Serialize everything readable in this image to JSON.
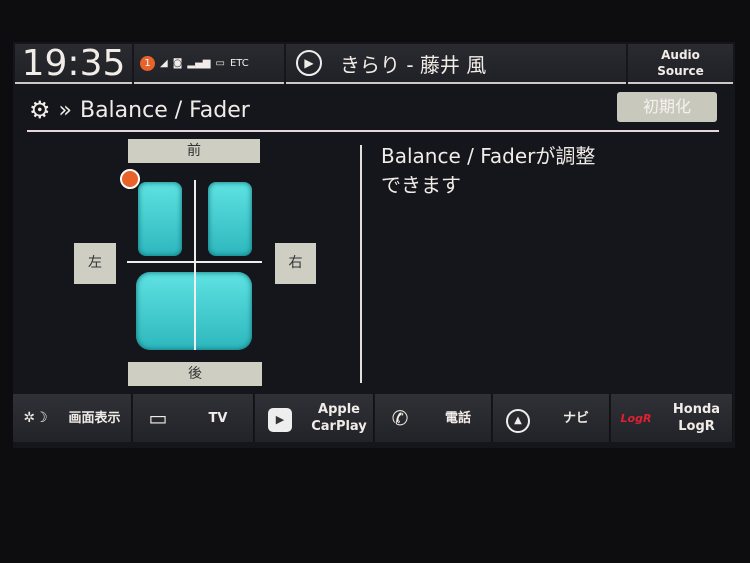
{
  "status_bar": {
    "time": "19:35",
    "notification_count": "1",
    "etc_label": "ETC",
    "now_playing": "きらり - 藤井 風",
    "audio_source": [
      "Audio",
      "Source"
    ]
  },
  "header": {
    "title": "Balance / Fader",
    "reset_button": "初期化"
  },
  "balance_fader": {
    "front": "前",
    "rear": "後",
    "left": "左",
    "right": "右",
    "seat_color": "#3cc8c8",
    "position_marker_color": "#e8632a"
  },
  "message": [
    "Balance / Faderが調整",
    "できます"
  ],
  "bottom_bar": [
    {
      "label": "画面表示",
      "icon": "brightness-icon"
    },
    {
      "label": "TV",
      "icon": "tv-icon"
    },
    {
      "label": "Apple CarPlay",
      "lines": [
        "Apple",
        "CarPlay"
      ],
      "icon": "carplay-icon"
    },
    {
      "label": "電話",
      "icon": "phone-icon"
    },
    {
      "label": "ナビ",
      "icon": "navigation-icon"
    },
    {
      "label": "Honda LogR",
      "lines": [
        "Honda",
        "LogR"
      ],
      "icon": "logr-icon"
    }
  ]
}
